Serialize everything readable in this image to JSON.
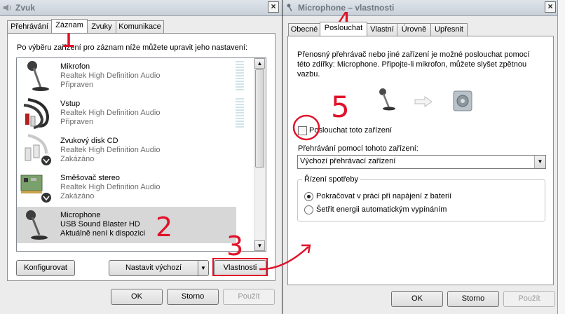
{
  "sound_dialog": {
    "title": "Zvuk",
    "close_glyph": "×",
    "tabs": [
      "Přehrávání",
      "Záznam",
      "Zvuky",
      "Komunikace"
    ],
    "instruction": "Po výběru zařízení pro záznam níže můžete upravit jeho nastavení:",
    "devices": [
      {
        "name": "Mikrofon",
        "driver": "Realtek High Definition Audio",
        "status": "Připraven",
        "icon": "microphone-icon"
      },
      {
        "name": "Vstup",
        "driver": "Realtek High Definition Audio",
        "status": "Připraven",
        "icon": "rca-cable-icon"
      },
      {
        "name": "Zvukový disk CD",
        "driver": "Realtek High Definition Audio",
        "status": "Zakázáno",
        "icon": "cd-cable-icon"
      },
      {
        "name": "Směšovač stereo",
        "driver": "Realtek High Definition Audio",
        "status": "Zakázáno",
        "icon": "sound-card-icon"
      },
      {
        "name": "Microphone",
        "driver": "USB Sound Blaster HD",
        "status": "Aktuálně není k dispozici",
        "icon": "microphone-icon"
      }
    ],
    "buttons": {
      "configure": "Konfigurovat",
      "set_default": "Nastavit výchozí",
      "properties": "Vlastnosti",
      "ok": "OK",
      "cancel": "Storno",
      "apply": "Použít"
    }
  },
  "mic_dialog": {
    "title": "Microphone – vlastnosti",
    "close_glyph": "×",
    "tabs": [
      "Obecné",
      "Poslouchat",
      "Vlastní",
      "Úrovně",
      "Upřesnit"
    ],
    "description": [
      "Přenosný přehrávač nebo jiné zařízení je možné poslouchat pomocí",
      "této zdířky: Microphone. Připojte-li mikrofon, můžete slyšet zpětnou",
      "vazbu."
    ],
    "listen_checkbox": "Poslouchat toto zařízení",
    "listen_checked": false,
    "playback_label": "Přehrávání pomocí tohoto zařízení:",
    "playback_value": "Výchozí přehrávací zařízení",
    "power_group": "Řízení spotřeby",
    "power_options": [
      "Pokračovat v práci při napájení z baterií",
      "Šetřit energii automatickým vypínáním"
    ],
    "power_selected": 0,
    "buttons": {
      "ok": "OK",
      "cancel": "Storno",
      "apply": "Použít"
    }
  },
  "annotations": [
    "1",
    "2",
    "3",
    "4",
    "5"
  ],
  "colors": {
    "annotation": "#e0122a",
    "selected_row": "#d7d7d7"
  }
}
